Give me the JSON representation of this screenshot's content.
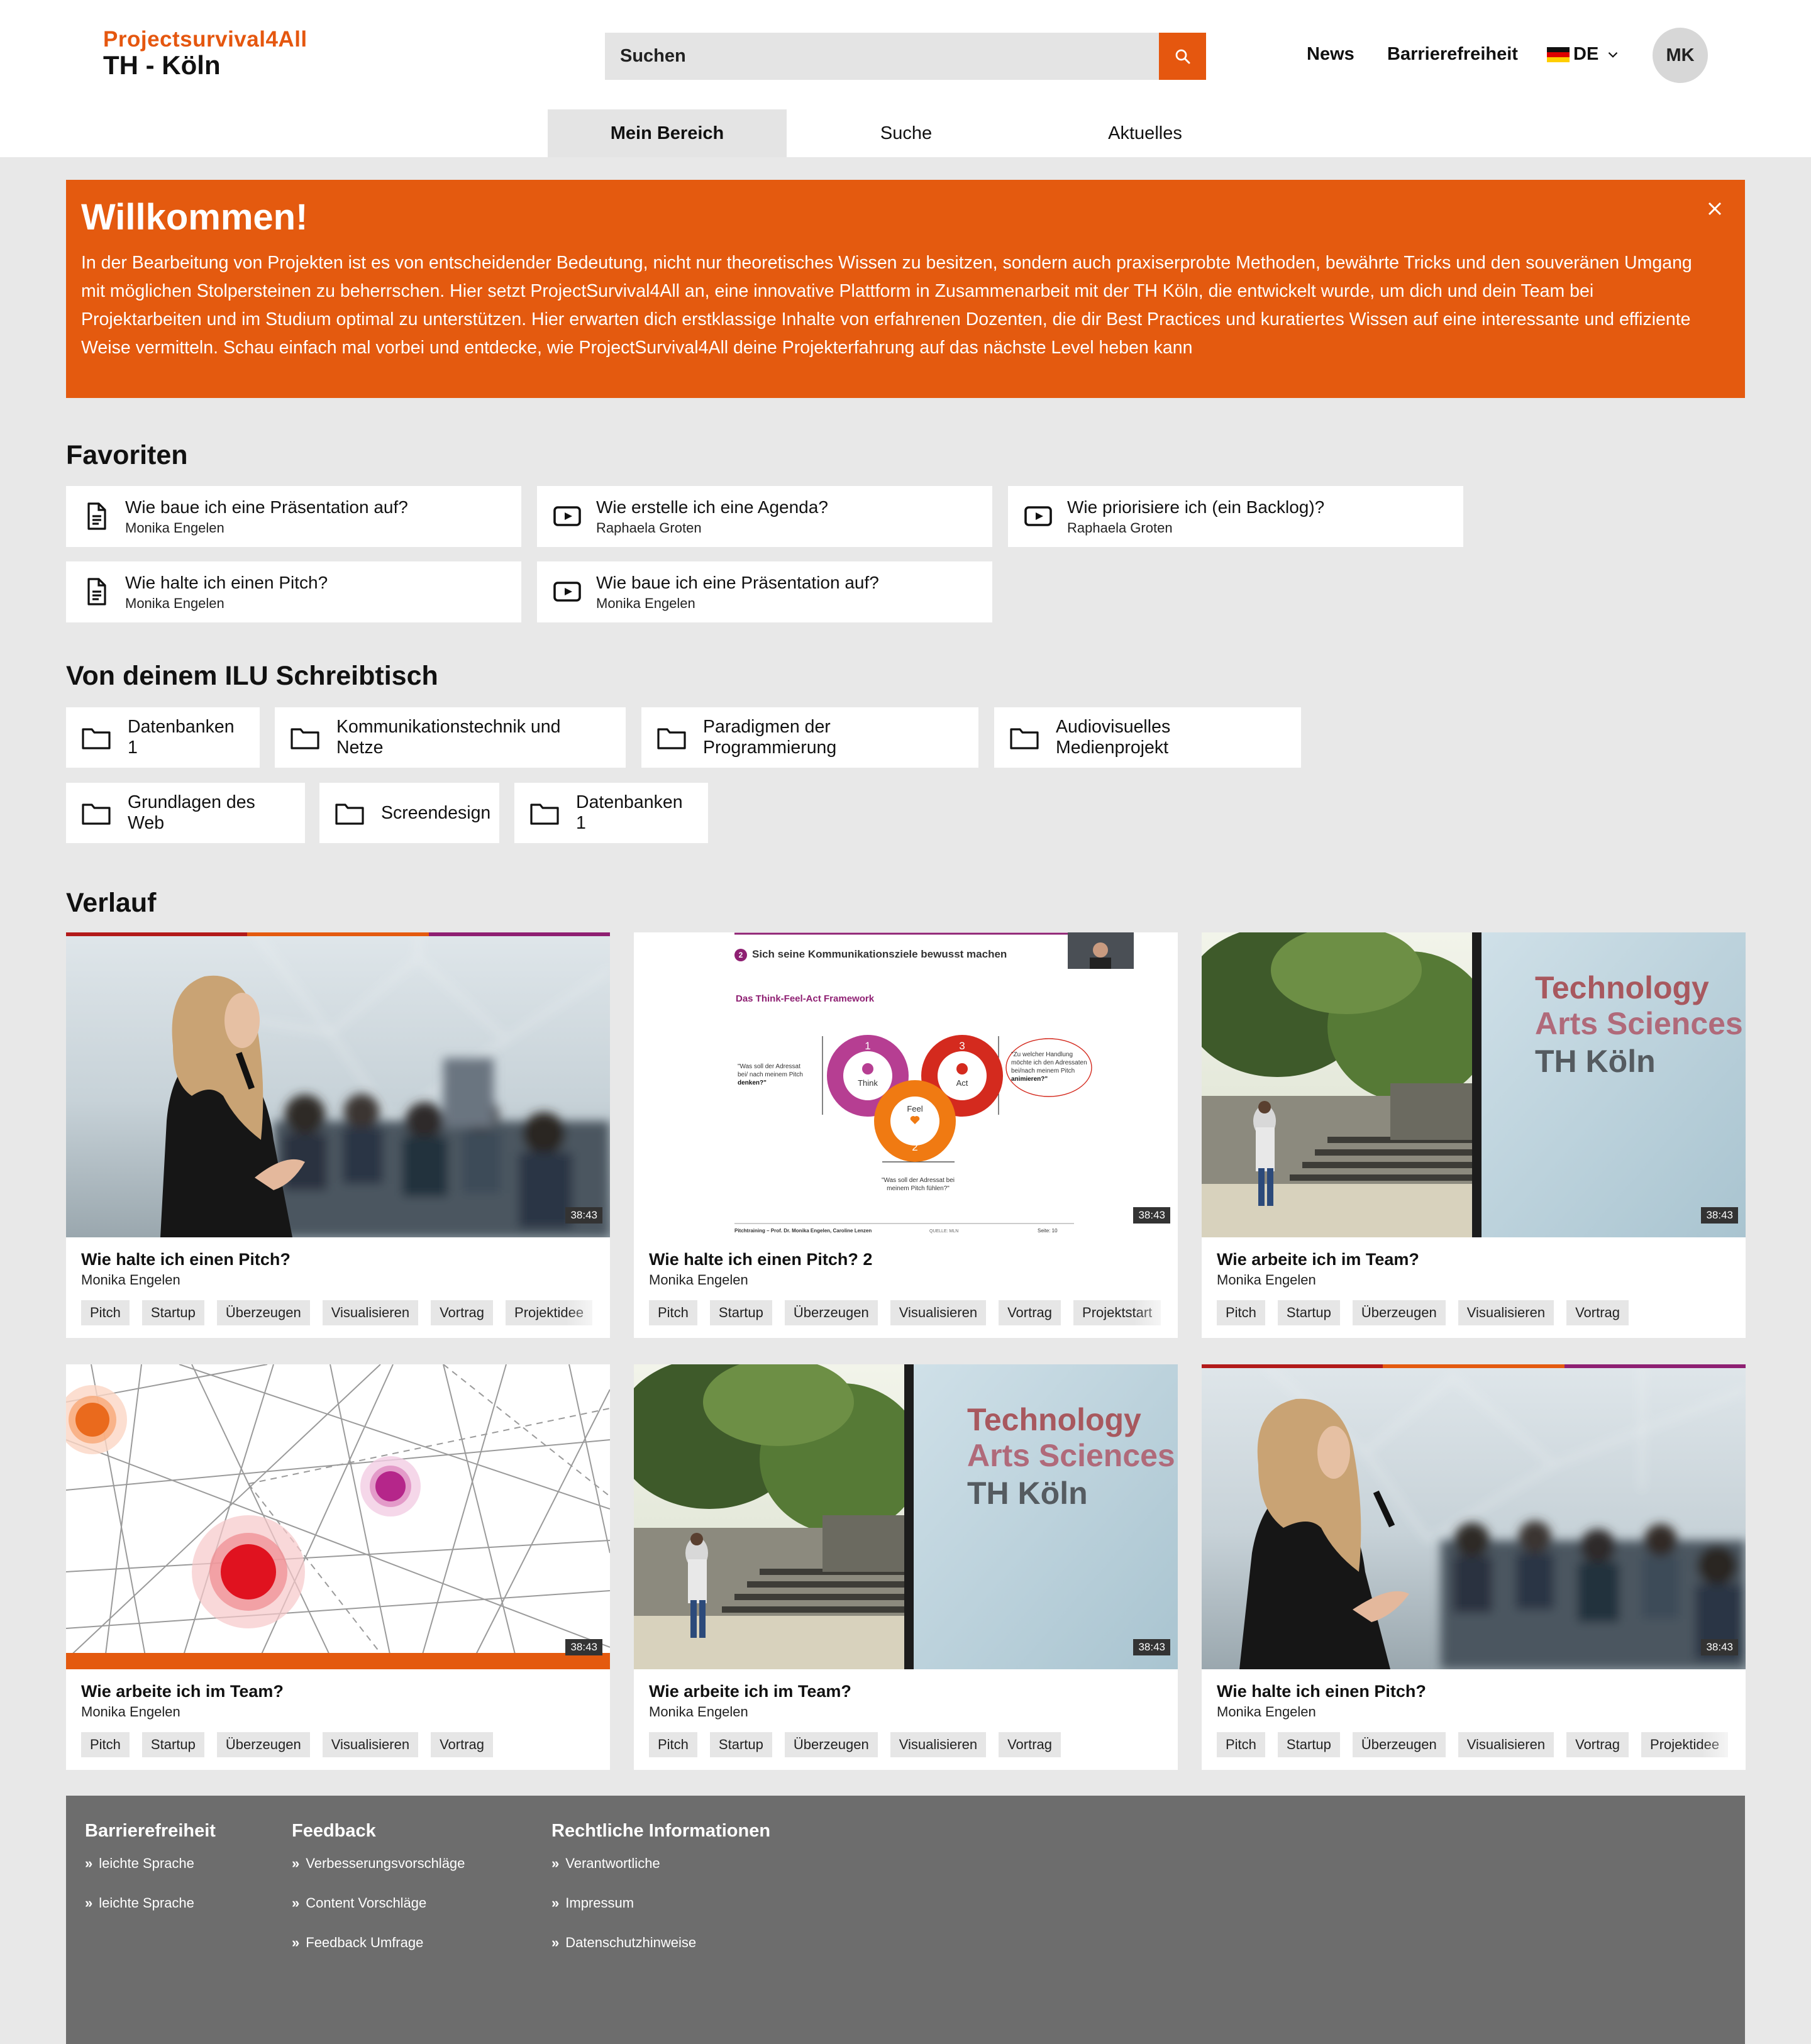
{
  "header": {
    "logo_line1": "Projectsurvival4All",
    "logo_line2": "TH - Köln",
    "search_placeholder": "Suchen",
    "nav_news": "News",
    "nav_accessibility": "Barrierefreiheit",
    "language": "DE",
    "avatar_initials": "MK",
    "accent": "#e5570f"
  },
  "tabs": [
    {
      "label": "Mein Bereich",
      "active": true
    },
    {
      "label": "Suche",
      "active": false
    },
    {
      "label": "Aktuelles",
      "active": false
    }
  ],
  "welcome": {
    "title": "Willkommen!",
    "text": "In der Bearbeitung von Projekten ist es von entscheidender Bedeutung, nicht nur theoretisches Wissen zu besitzen, sondern auch praxiserprobte Methoden, bewährte Tricks und den souveränen Umgang mit möglichen Stolpersteinen zu beherrschen. Hier setzt ProjectSurvival4All an, eine innovative Plattform in Zusammenarbeit mit der TH Köln, die entwickelt wurde, um dich und dein Team bei Projektarbeiten und im Studium optimal zu unterstützen. Hier erwarten dich erstklassige Inhalte von erfahrenen Dozenten, die dir Best Practices und kuratiertes Wissen auf eine interessante und effiziente Weise vermitteln. Schau einfach mal vorbei und entdecke, wie ProjectSurvival4All deine Projekterfahrung auf das nächste Level heben kann",
    "color": "#e45a0f"
  },
  "favorites": {
    "heading": "Favoriten",
    "items": [
      {
        "title": "Wie baue ich eine Präsentation auf?",
        "author": "Monika Engelen",
        "icon": "document-icon"
      },
      {
        "title": "Wie erstelle ich eine Agenda?",
        "author": "Raphaela Groten",
        "icon": "video-icon"
      },
      {
        "title": "Wie priorisiere ich (ein Backlog)?",
        "author": "Raphaela Groten",
        "icon": "video-icon"
      },
      {
        "title": "Wie halte ich einen Pitch?",
        "author": "Monika Engelen",
        "icon": "document-icon"
      },
      {
        "title": "Wie baue ich eine Präsentation auf?",
        "author": "Monika Engelen",
        "icon": "video-icon"
      }
    ]
  },
  "desk": {
    "heading": "Von deinem ILU Schreibtisch",
    "items": [
      "Datenbanken 1",
      "Kommunikationstechnik und Netze",
      "Paradigmen der Programmierung",
      "Audiovisuelles Medienprojekt",
      "Grundlagen des Web",
      "Screendesign",
      "Datenbanken 1"
    ]
  },
  "history": {
    "heading": "Verlauf",
    "items": [
      {
        "title": "Wie halte ich einen Pitch?",
        "author": "Monika Engelen",
        "duration": "38:43",
        "thumb": "speaker",
        "tags": [
          "Pitch",
          "Startup",
          "Überzeugen",
          "Visualisieren",
          "Vortrag",
          "Projektidee"
        ]
      },
      {
        "title": "Wie halte ich einen Pitch? 2",
        "author": "Monika Engelen",
        "duration": "38:43",
        "thumb": "slide",
        "tags": [
          "Pitch",
          "Startup",
          "Überzeugen",
          "Visualisieren",
          "Vortrag",
          "Projektstart"
        ]
      },
      {
        "title": "Wie arbeite ich im Team?",
        "author": "Monika Engelen",
        "duration": "38:43",
        "thumb": "campus",
        "tags": [
          "Pitch",
          "Startup",
          "Überzeugen",
          "Visualisieren",
          "Vortrag"
        ]
      },
      {
        "title": "Wie arbeite ich im Team?",
        "author": "Monika Engelen",
        "duration": "38:43",
        "thumb": "network",
        "tags": [
          "Pitch",
          "Startup",
          "Überzeugen",
          "Visualisieren",
          "Vortrag"
        ]
      },
      {
        "title": "Wie arbeite ich im Team?",
        "author": "Monika Engelen",
        "duration": "38:43",
        "thumb": "campus",
        "tags": [
          "Pitch",
          "Startup",
          "Überzeugen",
          "Visualisieren",
          "Vortrag"
        ]
      },
      {
        "title": "Wie halte ich einen Pitch?",
        "author": "Monika Engelen",
        "duration": "38:43",
        "thumb": "speaker",
        "tags": [
          "Pitch",
          "Startup",
          "Überzeugen",
          "Visualisieren",
          "Vortrag",
          "Projektidee"
        ]
      }
    ],
    "slide": {
      "heading": "Sich seine Kommunikationsziele bewusst machen",
      "subheading": "Das Think-Feel-Act Framework",
      "think": "Think",
      "feel": "Feel",
      "act": "Act",
      "n1": "1",
      "n2": "2",
      "n3": "3",
      "step": "2",
      "q_think_1": "\"Was soll der Adressat",
      "q_think_2": "bei/ nach meinem Pitch",
      "q_think_3": "denken?\"",
      "q_act_1": "\"Zu welcher Handlung",
      "q_act_2": "möchte ich den Adressaten",
      "q_act_3": "bei/nach meinem Pitch",
      "q_act_4": "animieren?\"",
      "q_feel_1": "\"Was soll der Adressat bei",
      "q_feel_2": "meinem Pitch fühlen?\"",
      "footer_left": "Pitchtraining – Prof. Dr. Monika Engelen, Caroline Lenzen",
      "footer_mid": "QUELLE: MLN",
      "footer_right": "Seite: 10"
    },
    "campus_sign": [
      "Technology",
      "Arts Sciences",
      "TH Köln"
    ]
  },
  "footer": {
    "columns": [
      {
        "heading": "Barrierefreiheit",
        "links": [
          "leichte Sprache",
          "leichte Sprache"
        ]
      },
      {
        "heading": "Feedback",
        "links": [
          "Verbesserungsvorschläge",
          "Content Vorschläge",
          "Feedback Umfrage"
        ]
      },
      {
        "heading": "Rechtliche Informationen",
        "links": [
          "Verantwortliche",
          "Impressum",
          "Datenschutzhinweise"
        ]
      }
    ],
    "bg": "#6d6d6d"
  }
}
